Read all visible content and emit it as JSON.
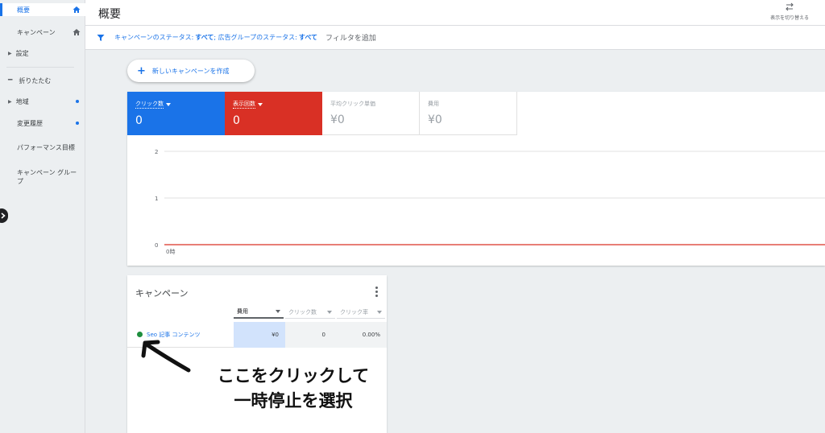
{
  "sidebar": {
    "items": [
      {
        "label": "概要",
        "icon": "home-icon",
        "active": true
      },
      {
        "label": "キャンペーン",
        "icon": "home-icon"
      },
      {
        "label": "設定",
        "icon": "caret-right-icon"
      },
      {
        "label": "折りたたむ",
        "icon": "minus-icon"
      },
      {
        "label": "地域",
        "icon": "caret-right-icon",
        "dot": true
      },
      {
        "label": "変更履歴",
        "dot": true
      },
      {
        "label": "パフォーマンス目標"
      },
      {
        "label": "キャンペーン グループ"
      }
    ]
  },
  "header": {
    "title": "概要",
    "toggle_label": "表示を切り替える"
  },
  "filter": {
    "campaign_status_label": "キャンペーンのステータス:",
    "campaign_status_value": "すべて",
    "adgroup_status_label": "; 広告グループのステータス:",
    "adgroup_status_value": "すべて",
    "add_filter": "フィルタを追加"
  },
  "new_campaign_button": "新しいキャンペーンを作成",
  "metrics": {
    "clicks": {
      "label": "クリック数",
      "value": "0",
      "color": "#1a73e8"
    },
    "impressions": {
      "label": "表示回数",
      "value": "0",
      "color": "#d93025"
    },
    "avg_cpc": {
      "label": "平均クリック単価",
      "value": "¥0"
    },
    "cost": {
      "label": "費用",
      "value": "¥0"
    }
  },
  "chart_data": {
    "type": "line",
    "x": [
      "0時"
    ],
    "yticks": [
      "2",
      "1",
      "0"
    ],
    "ylim": [
      0,
      2
    ],
    "series": [
      {
        "values": [
          0
        ],
        "color": "#d93025"
      }
    ]
  },
  "campaign_card": {
    "title": "キャンペーン",
    "columns": [
      "費用",
      "クリック数",
      "クリック率"
    ],
    "rows": [
      {
        "name": "Seo 記事 コンテンツ",
        "cost": "¥0",
        "clicks": "0",
        "ctr": "0.00%",
        "status_color": "#1e8e3e"
      }
    ]
  },
  "annotation": {
    "line1": "ここをクリックして",
    "line2": "一時停止を選択"
  }
}
